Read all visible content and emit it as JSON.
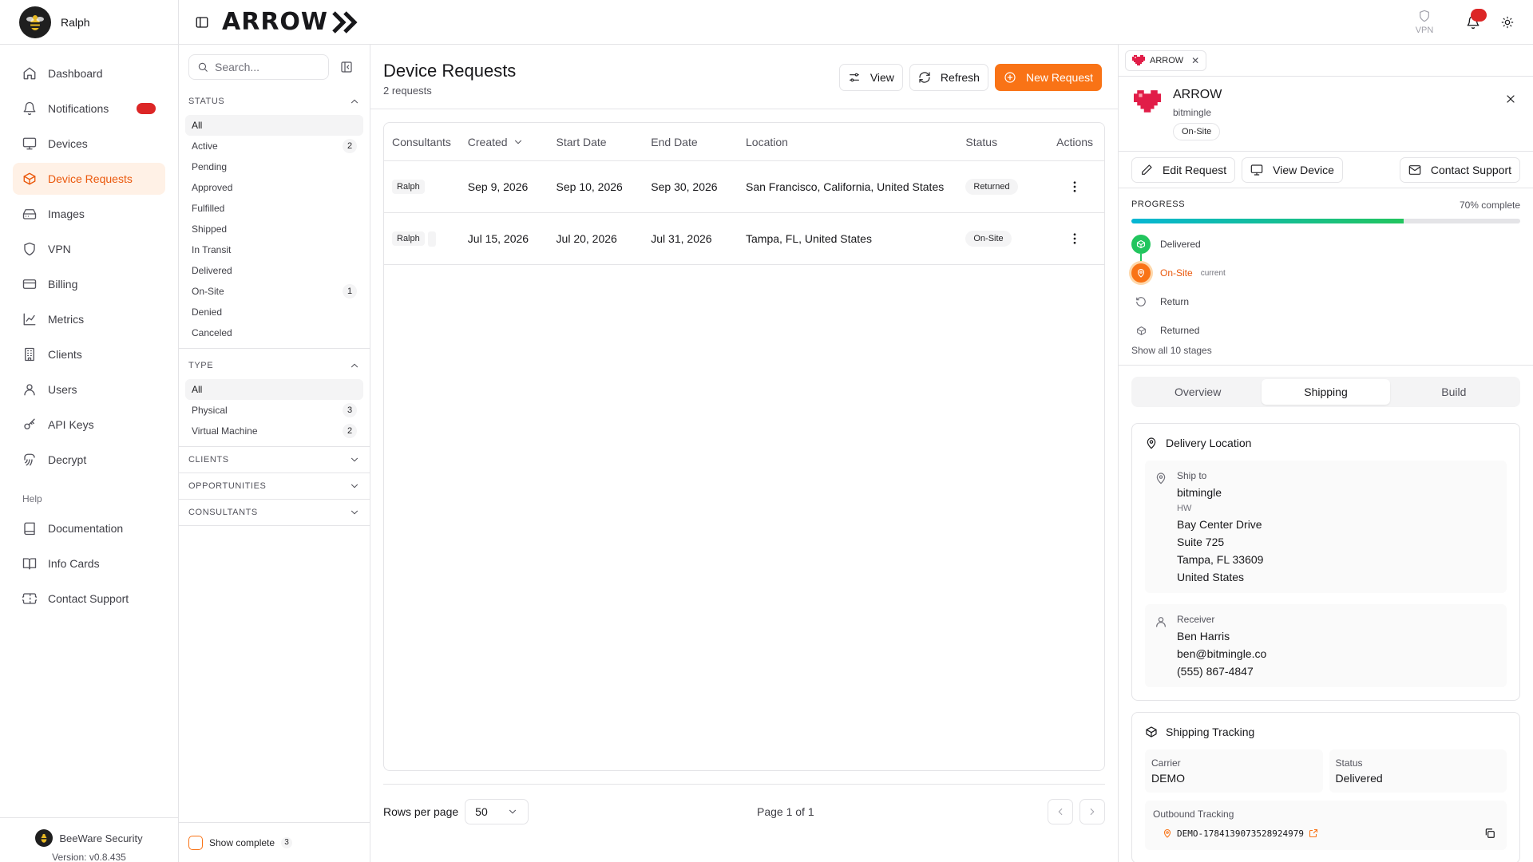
{
  "sidebar": {
    "user": "Ralph",
    "items": [
      {
        "label": "Dashboard",
        "icon": "home-icon"
      },
      {
        "label": "Notifications",
        "icon": "bell-icon"
      },
      {
        "label": "Devices",
        "icon": "monitor-icon"
      },
      {
        "label": "Device Requests",
        "icon": "box-icon"
      },
      {
        "label": "Images",
        "icon": "hard-drive-icon"
      },
      {
        "label": "VPN",
        "icon": "shield-icon"
      },
      {
        "label": "Billing",
        "icon": "credit-card-icon"
      },
      {
        "label": "Metrics",
        "icon": "line-chart-icon"
      },
      {
        "label": "Clients",
        "icon": "building-icon"
      },
      {
        "label": "Users",
        "icon": "user-icon"
      },
      {
        "label": "API Keys",
        "icon": "key-icon"
      },
      {
        "label": "Decrypt",
        "icon": "lock-icon"
      }
    ],
    "help_label": "Help",
    "help_items": [
      {
        "label": "Documentation",
        "icon": "book-icon"
      },
      {
        "label": "Info Cards",
        "icon": "book-open-icon"
      },
      {
        "label": "Contact Support",
        "icon": "ticket-icon"
      }
    ],
    "org": "BeeWare Security",
    "version": "Version: v0.8.435"
  },
  "topbar": {
    "brand": "ARROW",
    "vpn_label": "VPN"
  },
  "filters": {
    "search_placeholder": "Search...",
    "status_title": "STATUS",
    "status": [
      {
        "label": "All",
        "count": ""
      },
      {
        "label": "Active",
        "count": "2"
      },
      {
        "label": "Pending",
        "count": ""
      },
      {
        "label": "Approved",
        "count": ""
      },
      {
        "label": "Fulfilled",
        "count": ""
      },
      {
        "label": "Shipped",
        "count": ""
      },
      {
        "label": "In Transit",
        "count": ""
      },
      {
        "label": "Delivered",
        "count": ""
      },
      {
        "label": "On-Site",
        "count": "1"
      },
      {
        "label": "Denied",
        "count": ""
      },
      {
        "label": "Canceled",
        "count": ""
      }
    ],
    "type_title": "TYPE",
    "type": [
      {
        "label": "All",
        "count": ""
      },
      {
        "label": "Physical",
        "count": "3"
      },
      {
        "label": "Virtual Machine",
        "count": "2"
      }
    ],
    "clients_title": "CLIENTS",
    "opportunities_title": "OPPORTUNITIES",
    "consultants_title": "CONSULTANTS",
    "show_complete": "Show complete",
    "show_complete_count": "3"
  },
  "main": {
    "title": "Device Requests",
    "subtitle": "2 requests",
    "view_label": "View",
    "refresh_label": "Refresh",
    "new_label": "New Request",
    "columns": [
      "Consultants",
      "Created",
      "Start Date",
      "End Date",
      "Location",
      "Status",
      "Actions"
    ],
    "rows": [
      {
        "consultant": "Ralph",
        "created": "Sep 9, 2026",
        "start": "Sep 10, 2026",
        "end": "Sep 30, 2026",
        "location": "San Francisco, California, United States",
        "status": "Returned"
      },
      {
        "consultant": "Ralph",
        "created": "Jul 15, 2026",
        "start": "Jul 20, 2026",
        "end": "Jul 31, 2026",
        "location": "Tampa, FL, United States",
        "status": "On-Site"
      }
    ],
    "rows_per_page_label": "Rows per page",
    "rows_per_page": "50",
    "page_info": "Page 1 of 1"
  },
  "detail": {
    "chip": "ARROW",
    "name": "ARROW",
    "client": "bitmingle",
    "status": "On-Site",
    "edit_label": "Edit Request",
    "view_device_label": "View Device",
    "contact_label": "Contact Support",
    "progress_title": "PROGRESS",
    "progress_pct_text": "70% complete",
    "progress_fraction": 0.7,
    "stages": [
      {
        "label": "Delivered",
        "state": "done"
      },
      {
        "label": "On-Site",
        "state": "current",
        "tag": "current"
      },
      {
        "label": "Return",
        "state": "todo"
      },
      {
        "label": "Returned",
        "state": "todo"
      }
    ],
    "show_all": "Show all 10 stages",
    "tabs": [
      "Overview",
      "Shipping",
      "Build"
    ],
    "delivery_title": "Delivery Location",
    "ship_to_label": "Ship to",
    "ship_to": {
      "company": "bitmingle",
      "attn": "HW",
      "line1": "Bay Center Drive",
      "line2": "Suite 725",
      "city": "Tampa, FL 33609",
      "country": "United States"
    },
    "receiver_label": "Receiver",
    "receiver": {
      "name": "Ben Harris",
      "email": "ben@bitmingle.co",
      "phone": "(555) 867-4847"
    },
    "tracking_title": "Shipping Tracking",
    "carrier_label": "Carrier",
    "carrier": "DEMO",
    "ship_status_label": "Status",
    "ship_status": "Delivered",
    "outbound_label": "Outbound Tracking",
    "outbound_code": "DEMO-1784139073528924979"
  },
  "colors": {
    "accent": "#f97316",
    "badge": "#dc2626",
    "progress_start": "#06b6d4",
    "progress_end": "#22c55e"
  }
}
